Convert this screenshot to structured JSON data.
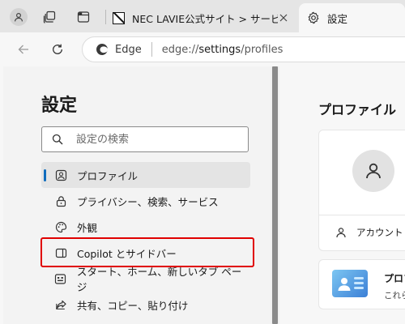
{
  "tabs": [
    {
      "title": "NEC LAVIE公式サイト > サービス＆サ",
      "active": false
    },
    {
      "title": "設定",
      "active": true
    }
  ],
  "toolbar": {
    "edge_label": "Edge",
    "url_prefix": "edge://",
    "url_host": "settings",
    "url_path": "/profiles"
  },
  "sidebar": {
    "title": "設定",
    "search_placeholder": "設定の検索",
    "items": [
      {
        "label": "プロファイル",
        "icon": "profile-icon",
        "selected": true
      },
      {
        "label": "プライバシー、検索、サービス",
        "icon": "lock-icon",
        "selected": false
      },
      {
        "label": "外観",
        "icon": "palette-icon",
        "selected": false
      },
      {
        "label": "Copilot とサイドバー",
        "icon": "sidebar-icon",
        "selected": false,
        "highlighted": true
      },
      {
        "label": "スタート、ホーム、新しいタブ ページ",
        "icon": "home-grid-icon",
        "selected": false
      },
      {
        "label": "共有、コピー、貼り付け",
        "icon": "share-icon",
        "selected": false
      }
    ]
  },
  "main": {
    "title": "プロファイル",
    "account_label": "アカウント",
    "promo_title": "プロフ",
    "promo_text": "これら"
  },
  "colors": {
    "highlight": "#e00000",
    "selected_indicator": "#0f6cbd"
  }
}
